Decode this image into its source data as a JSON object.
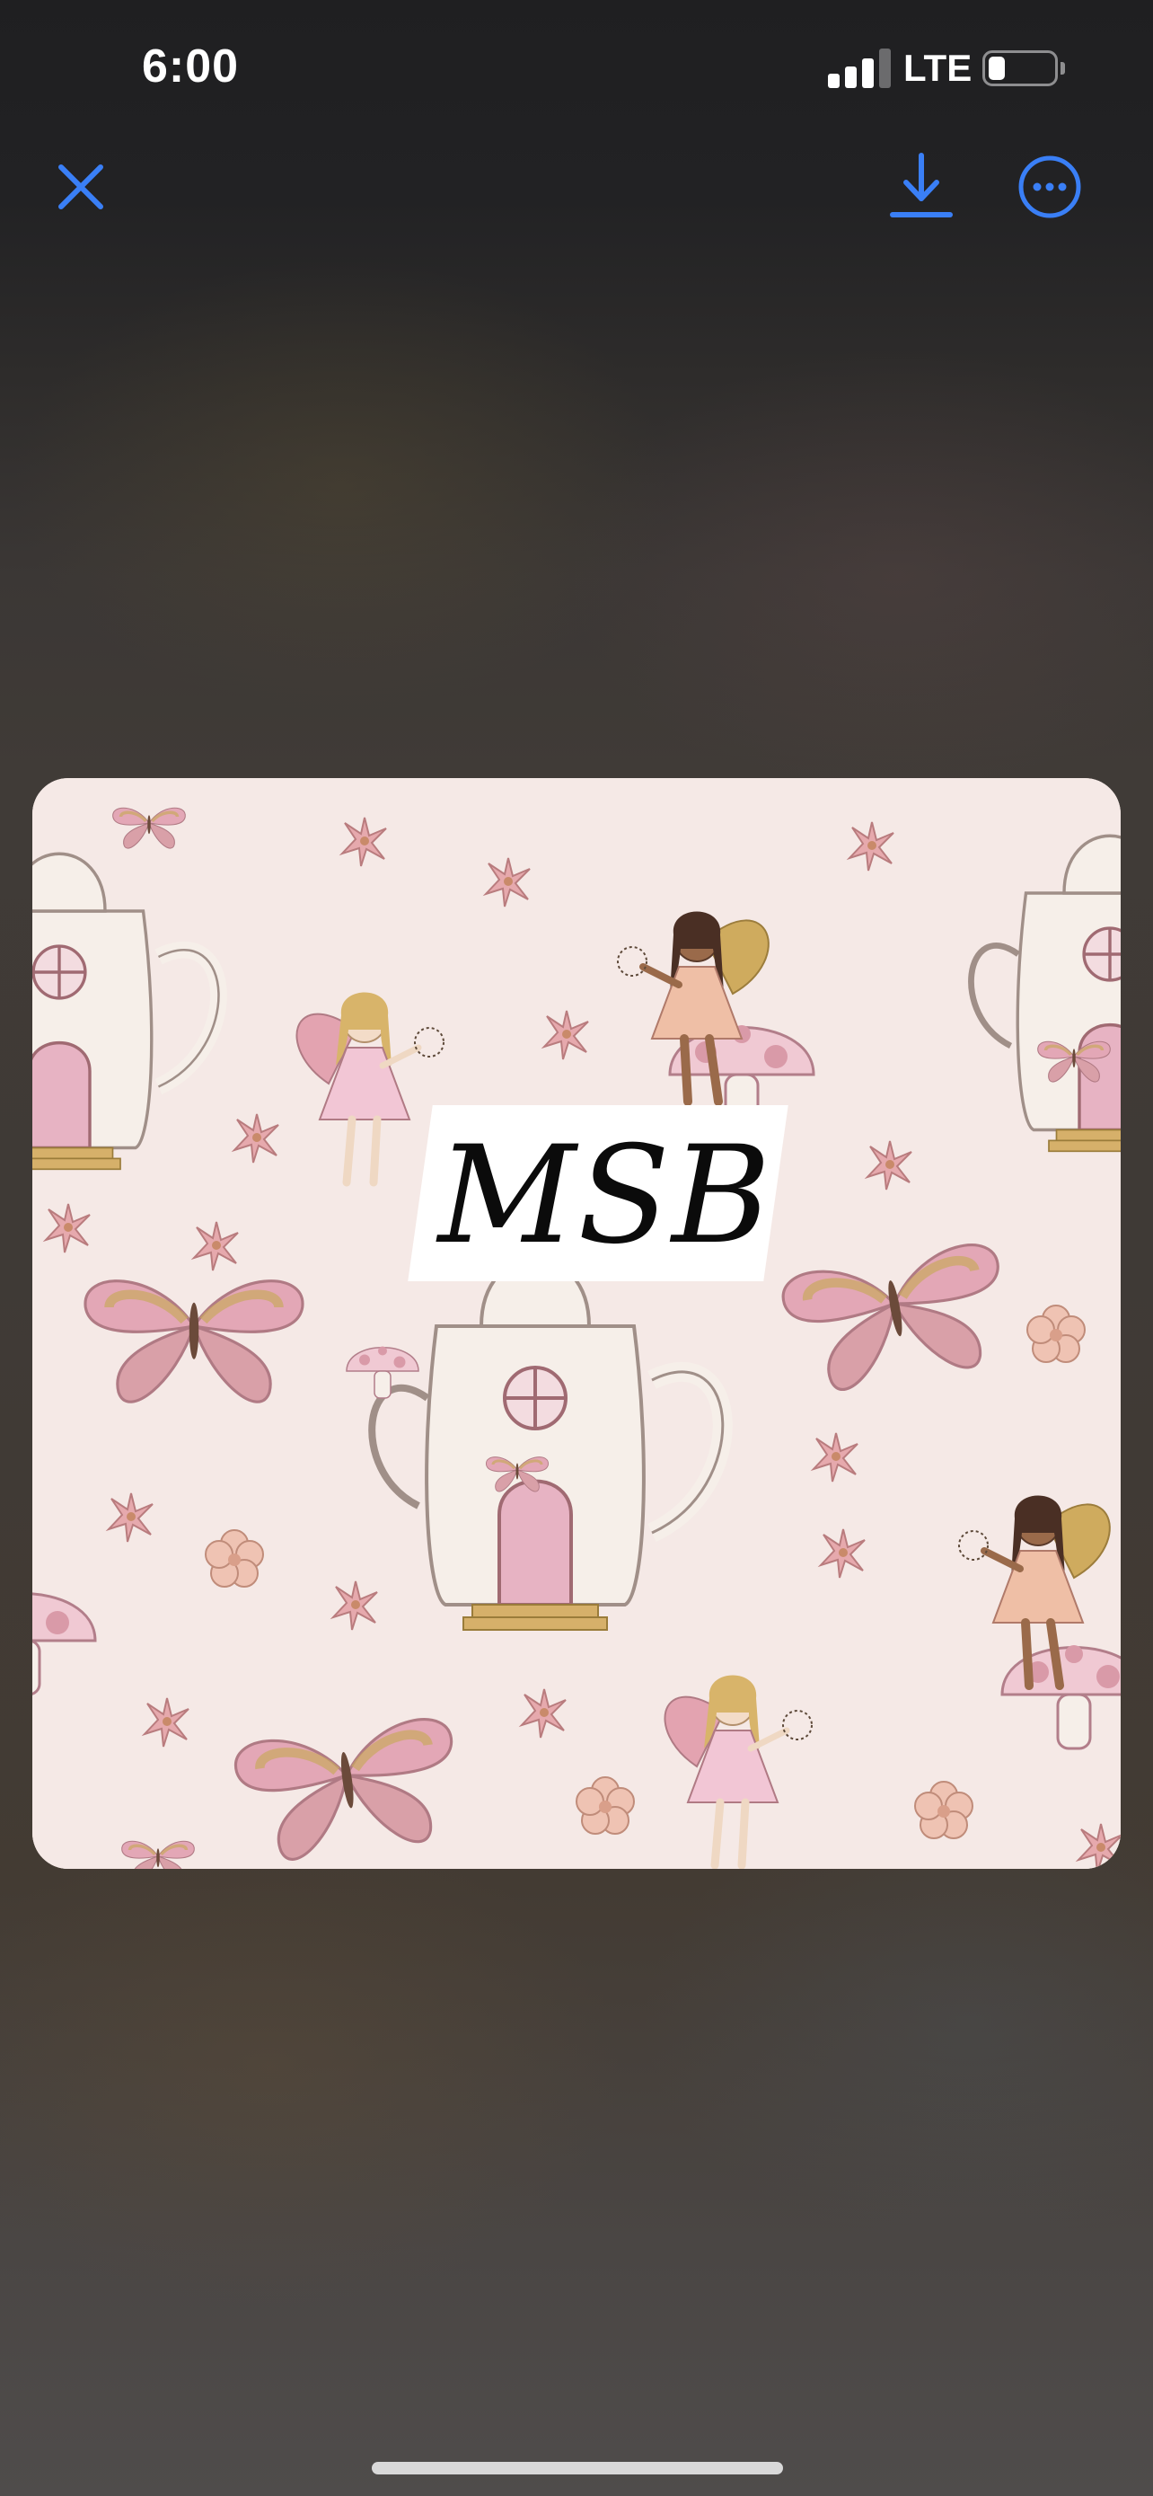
{
  "status_bar": {
    "time": "6:00",
    "network": "LTE",
    "battery_level": 0.25,
    "signal_bars": 3
  },
  "toolbar": {
    "close_icon": "close-x-icon",
    "download_icon": "download-icon",
    "more_icon": "ellipsis-circle-icon",
    "accent_color": "#3a7ff6"
  },
  "image": {
    "logo_text": "MSB",
    "background_color": "#f5e9e6"
  }
}
